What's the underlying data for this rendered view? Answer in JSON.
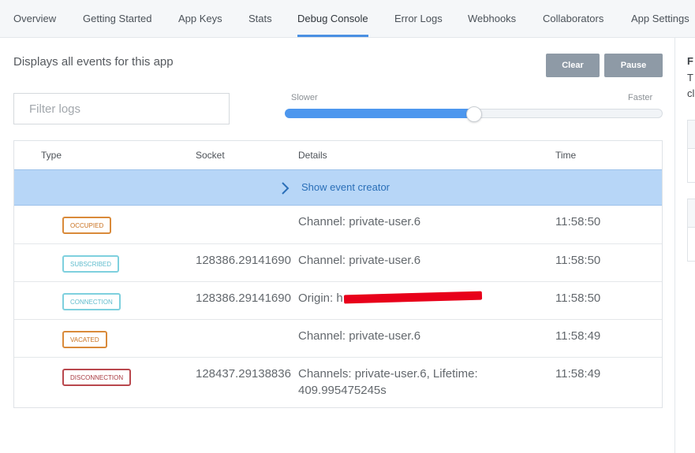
{
  "nav": {
    "items": [
      {
        "label": "Overview"
      },
      {
        "label": "Getting Started"
      },
      {
        "label": "App Keys"
      },
      {
        "label": "Stats"
      },
      {
        "label": "Debug Console"
      },
      {
        "label": "Error Logs"
      },
      {
        "label": "Webhooks"
      },
      {
        "label": "Collaborators"
      },
      {
        "label": "App Settings"
      }
    ],
    "active": "Debug Console"
  },
  "description": "Displays all events for this app",
  "buttons": {
    "clear": "Clear",
    "pause": "Pause"
  },
  "filter": {
    "placeholder": "Filter logs",
    "value": ""
  },
  "speed": {
    "slower_label": "Slower",
    "faster_label": "Faster",
    "value_percent": 50
  },
  "table": {
    "headers": {
      "type": "Type",
      "socket": "Socket",
      "details": "Details",
      "time": "Time"
    },
    "event_creator_label": "Show event creator",
    "rows": [
      {
        "type": "OCCUPIED",
        "socket": "",
        "details": "Channel: private-user.6",
        "time": "11:58:50"
      },
      {
        "type": "SUBSCRIBED",
        "socket": "128386.29141690",
        "details": "Channel: private-user.6",
        "time": "11:58:50"
      },
      {
        "type": "CONNECTION",
        "socket": "128386.29141690",
        "details": "Origin: h",
        "time": "11:58:50"
      },
      {
        "type": "VACATED",
        "socket": "",
        "details": "Channel: private-user.6",
        "time": "11:58:49"
      },
      {
        "type": "DISCONNECTION",
        "socket": "128437.29138836",
        "details": "Channels: private-user.6, Lifetime: 409.995475245s",
        "time": "11:58:49"
      }
    ]
  },
  "side_panel": {
    "line1": "F",
    "line2": "T",
    "line3": "cl"
  },
  "colors": {
    "accent": "#4a90e2",
    "button_bg": "#8e9aa6",
    "creator_bg": "#b7d6f7",
    "occupied": "#d98a3a",
    "subscribed": "#7ed0de",
    "disconnection": "#b9474d",
    "redaction": "#e8001a"
  }
}
